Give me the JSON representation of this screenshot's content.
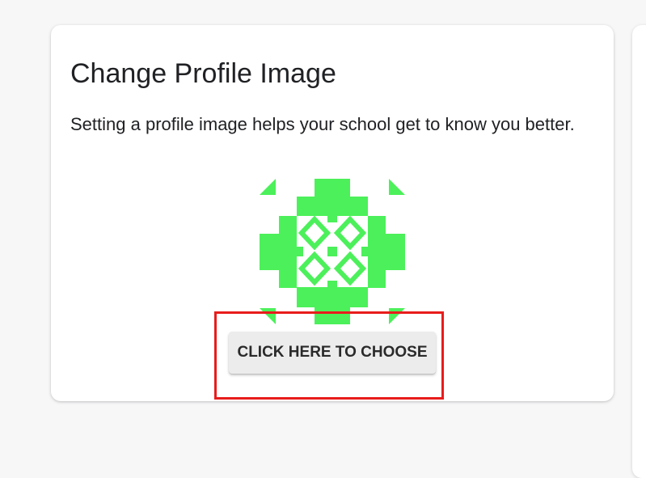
{
  "profile_card": {
    "title": "Change Profile Image",
    "description": "Setting a profile image helps your school get to know you better.",
    "avatar_icon": "identicon-avatar",
    "avatar_color": "#4cf05a",
    "choose_button_label": "CLICK HERE TO CHOOSE"
  },
  "highlight_color": "#e81c1c"
}
